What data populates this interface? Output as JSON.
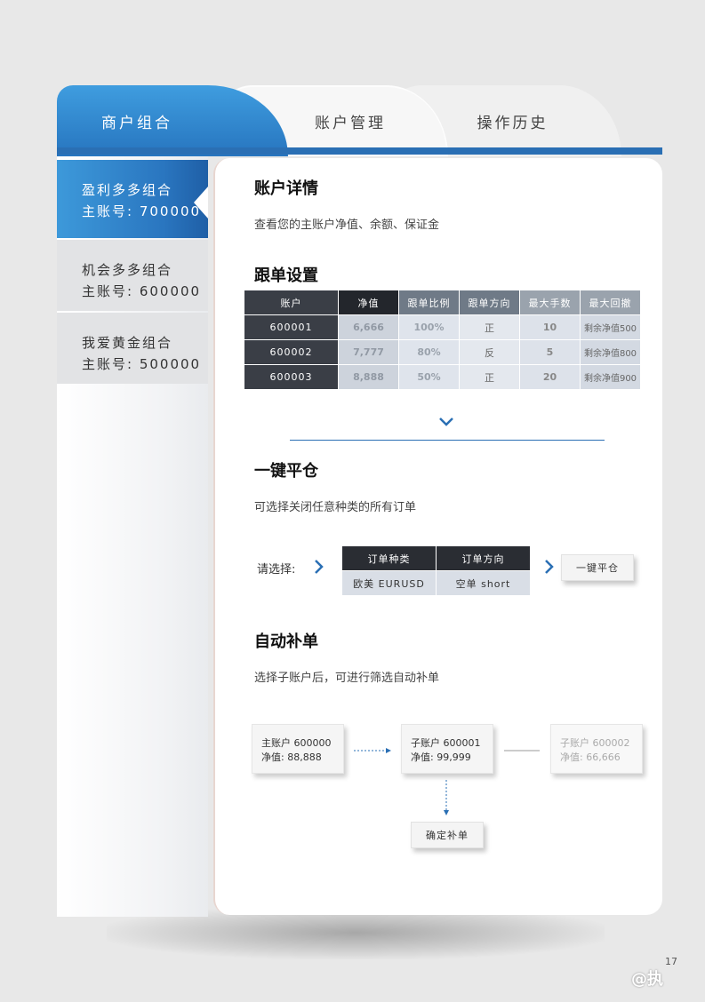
{
  "tabs": [
    {
      "label": "商户组合"
    },
    {
      "label": "账户管理"
    },
    {
      "label": "操作历史"
    }
  ],
  "sidebar": {
    "items": [
      {
        "name": "盈利多多组合",
        "account": "主账号: 700000"
      },
      {
        "name": "机会多多组合",
        "account": "主账号: 600000"
      },
      {
        "name": "我爱黄金组合",
        "account": "主账号: 500000"
      }
    ]
  },
  "account_detail": {
    "title": "账户详情",
    "desc": "查看您的主账户净值、余额、保证金"
  },
  "follow_settings": {
    "title": "跟单设置",
    "headers": [
      "账户",
      "净值",
      "跟单比例",
      "跟单方向",
      "最大手数",
      "最大回撤"
    ],
    "rows": [
      [
        "600001",
        "6,666",
        "100%",
        "正",
        "10",
        "剩余净值500"
      ],
      [
        "600002",
        "7,777",
        "80%",
        "反",
        "5",
        "剩余净值800"
      ],
      [
        "600003",
        "8,888",
        "50%",
        "正",
        "20",
        "剩余净值900"
      ]
    ]
  },
  "close_all": {
    "title": "一键平仓",
    "desc": "可选择关闭任意种类的所有订单",
    "select_label": "请选择:",
    "headers": [
      "订单种类",
      "订单方向"
    ],
    "values": [
      "欧美 EURUSD",
      "空单 short"
    ],
    "button": "一键平仓"
  },
  "auto_fill": {
    "title": "自动补单",
    "desc": "选择子账户后，可进行筛选自动补单",
    "main_account": {
      "line1": "主账户  600000",
      "line2": "净值: 88,888"
    },
    "sub_account_1": {
      "line1": "子账户  600001",
      "line2": "净值: 99,999"
    },
    "sub_account_2": {
      "line1": "子账户  600002",
      "line2": "净值: 66,666"
    },
    "confirm_button": "确定补单"
  },
  "footer": {
    "page_number": "17",
    "watermark": "@执"
  },
  "colors": {
    "accent_blue": "#2a76c0",
    "dark_header": "#2a2d33"
  }
}
